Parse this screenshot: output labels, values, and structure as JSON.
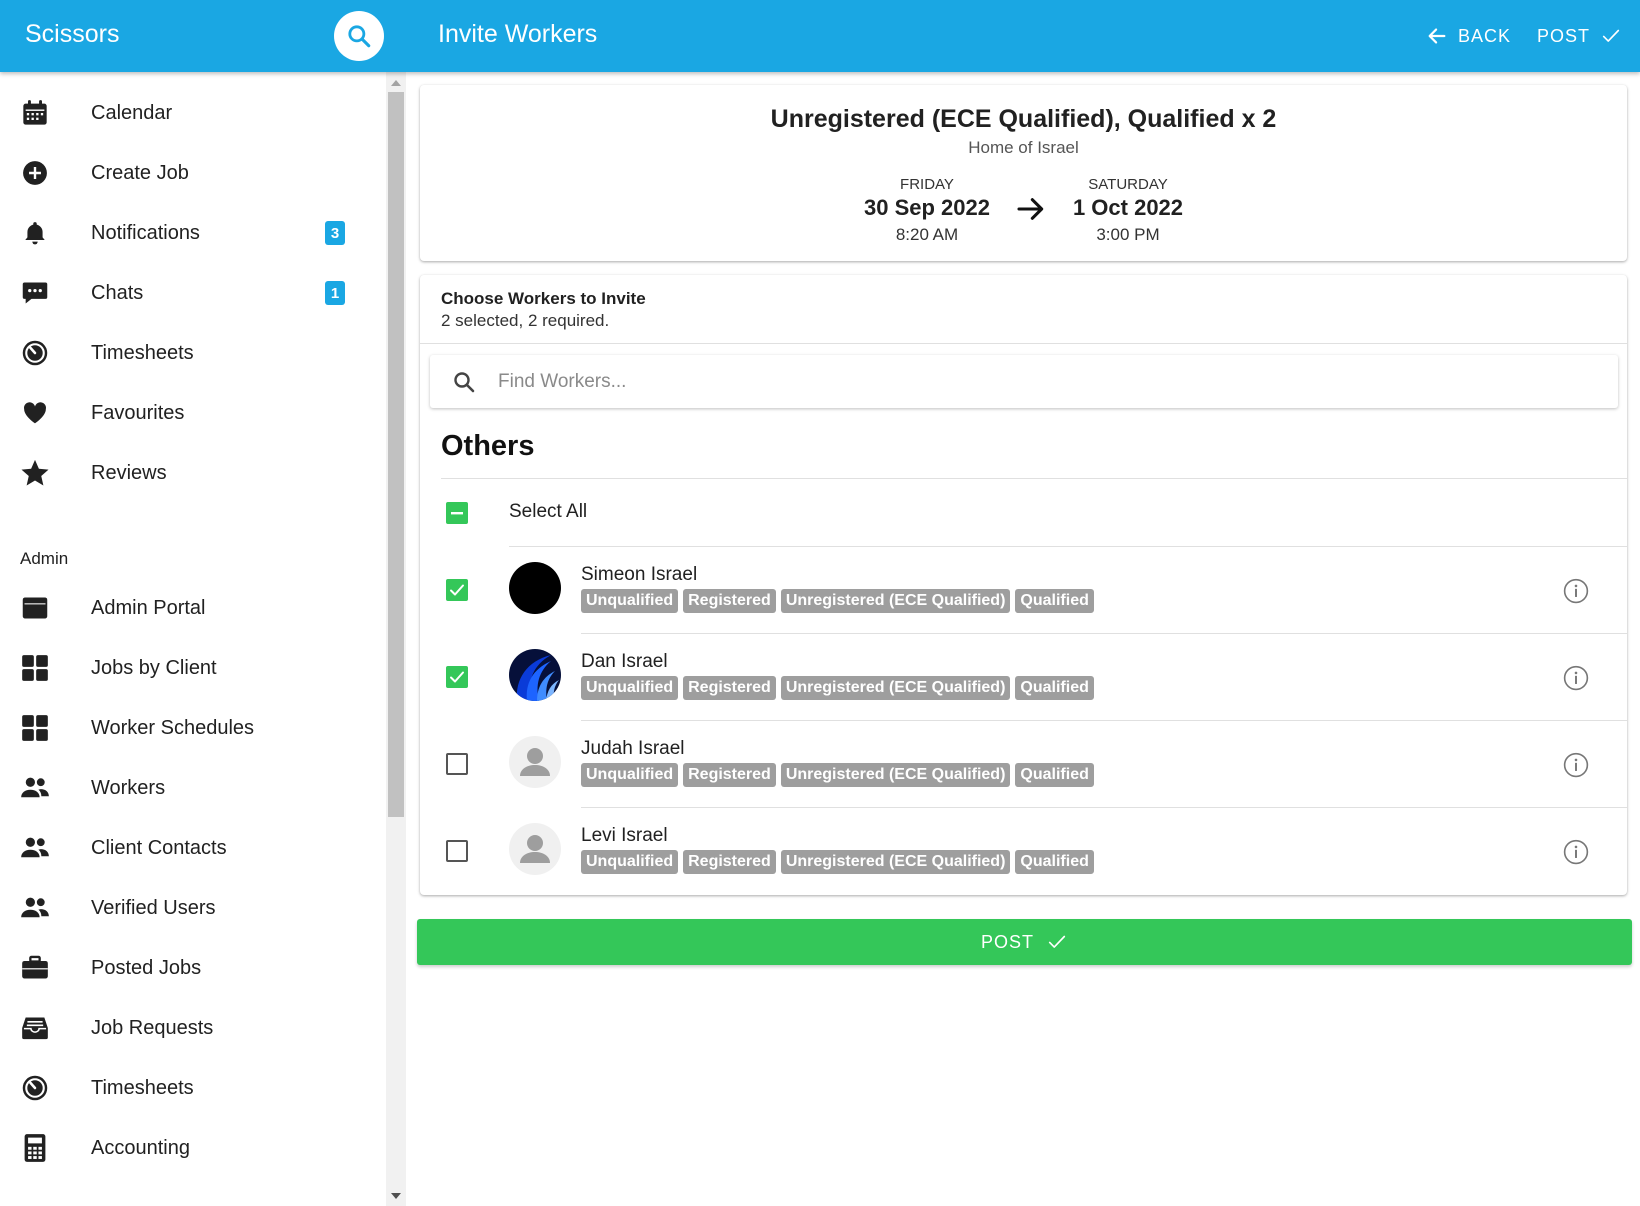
{
  "app": {
    "brand": "Scissors",
    "page_title": "Invite Workers",
    "back_label": "BACK",
    "post_label": "POST",
    "accent_color": "#1aa7e3",
    "success_color": "#34c759"
  },
  "sidebar": {
    "items": [
      {
        "label": "Calendar",
        "icon": "calendar-icon"
      },
      {
        "label": "Create Job",
        "icon": "add-circle-icon"
      },
      {
        "label": "Notifications",
        "icon": "bell-icon",
        "badge": "3"
      },
      {
        "label": "Chats",
        "icon": "chat-icon",
        "badge": "1"
      },
      {
        "label": "Timesheets",
        "icon": "timer-icon"
      },
      {
        "label": "Favourites",
        "icon": "heart-icon"
      },
      {
        "label": "Reviews",
        "icon": "star-icon"
      }
    ],
    "admin_header": "Admin",
    "admin_items": [
      {
        "label": "Admin Portal",
        "icon": "browser-window-icon"
      },
      {
        "label": "Jobs by Client",
        "icon": "grid-icon"
      },
      {
        "label": "Worker Schedules",
        "icon": "grid-icon"
      },
      {
        "label": "Workers",
        "icon": "people-icon"
      },
      {
        "label": "Client Contacts",
        "icon": "people-icon"
      },
      {
        "label": "Verified Users",
        "icon": "people-icon"
      },
      {
        "label": "Posted Jobs",
        "icon": "briefcase-icon"
      },
      {
        "label": "Job Requests",
        "icon": "inbox-icon"
      },
      {
        "label": "Timesheets",
        "icon": "timer-icon"
      },
      {
        "label": "Accounting",
        "icon": "calculator-icon"
      }
    ]
  },
  "job": {
    "title": "Unregistered (ECE Qualified), Qualified x 2",
    "location": "Home of Israel",
    "start": {
      "day": "FRIDAY",
      "date": "30 Sep 2022",
      "time": "8:20 AM"
    },
    "end": {
      "day": "SATURDAY",
      "date": "1 Oct 2022",
      "time": "3:00 PM"
    }
  },
  "workers_panel": {
    "title": "Choose Workers to Invite",
    "subtitle": "2 selected, 2 required.",
    "search_placeholder": "Find Workers...",
    "section_title": "Others",
    "select_all_label": "Select All",
    "select_all_state": "indeterminate",
    "workers": [
      {
        "name": "Simeon Israel",
        "checked": true,
        "avatar": "black-circle-avatar",
        "tags": [
          "Unqualified",
          "Registered",
          "Unregistered (ECE Qualified)",
          "Qualified"
        ]
      },
      {
        "name": "Dan Israel",
        "checked": true,
        "avatar": "blue-wave-avatar",
        "tags": [
          "Unqualified",
          "Registered",
          "Unregistered (ECE Qualified)",
          "Qualified"
        ]
      },
      {
        "name": "Judah Israel",
        "checked": false,
        "avatar": "default-person-avatar",
        "tags": [
          "Unqualified",
          "Registered",
          "Unregistered (ECE Qualified)",
          "Qualified"
        ]
      },
      {
        "name": "Levi Israel",
        "checked": false,
        "avatar": "default-person-avatar",
        "tags": [
          "Unqualified",
          "Registered",
          "Unregistered (ECE Qualified)",
          "Qualified"
        ]
      }
    ]
  },
  "footer": {
    "post_button_label": "POST"
  }
}
